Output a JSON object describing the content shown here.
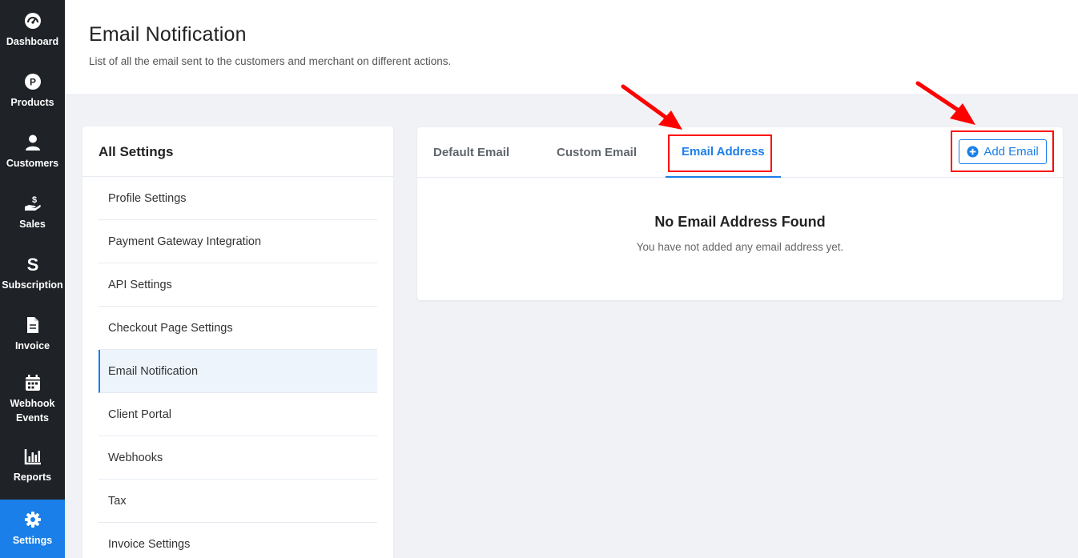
{
  "sidebar": {
    "items": [
      {
        "label": "Dashboard",
        "icon": "gauge-icon"
      },
      {
        "label": "Products",
        "icon": "product-p-icon"
      },
      {
        "label": "Customers",
        "icon": "user-icon"
      },
      {
        "label": "Sales",
        "icon": "hand-dollar-icon"
      },
      {
        "label": "Subscription",
        "icon": "subscription-s-icon"
      },
      {
        "label": "Invoice",
        "icon": "document-icon"
      },
      {
        "label": "Webhook Events",
        "icon": "calendar-icon"
      },
      {
        "label": "Reports",
        "icon": "bar-chart-icon"
      },
      {
        "label": "Settings",
        "icon": "gear-icon",
        "active": true
      }
    ]
  },
  "header": {
    "title": "Email Notification",
    "subtitle": "List of all the email sent to the customers and merchant on different actions."
  },
  "settings": {
    "heading": "All Settings",
    "items": [
      {
        "label": "Profile Settings"
      },
      {
        "label": "Payment Gateway Integration"
      },
      {
        "label": "API Settings"
      },
      {
        "label": "Checkout Page Settings"
      },
      {
        "label": "Email Notification",
        "active": true
      },
      {
        "label": "Client Portal"
      },
      {
        "label": "Webhooks"
      },
      {
        "label": "Tax"
      },
      {
        "label": "Invoice Settings"
      }
    ]
  },
  "main": {
    "tabs": [
      {
        "label": "Default Email"
      },
      {
        "label": "Custom Email"
      },
      {
        "label": "Email Address",
        "active": true
      }
    ],
    "add_button_label": "Add Email",
    "empty_title": "No Email Address Found",
    "empty_description": "You have not added any email address yet."
  },
  "colors": {
    "sidebar_bg": "#1f2227",
    "accent": "#1a7fe8",
    "annotation": "#ff0000",
    "page_bg": "#f0f2f6"
  }
}
